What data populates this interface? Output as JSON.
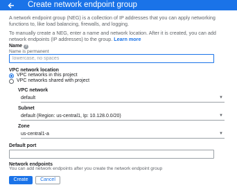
{
  "header": {
    "title": "Create network endpoint group"
  },
  "intro": {
    "paragraph1": "A network endpoint group (NEG) is a collection of IP addresses that you can apply networking functions to, like load balancing, firewalls, and logging.",
    "paragraph2": "To manually create a NEG, enter a name and network location. After it is created, you can add network endpoints (IP addresses) to the group.",
    "learn_more": "Learn more"
  },
  "name_field": {
    "label": "Name",
    "sublabel": "Name is permanent",
    "placeholder": "lowercase, no spaces",
    "value": ""
  },
  "vpc_location": {
    "label": "VPC network location",
    "options": [
      {
        "label": "VPC networks in this project",
        "selected": true
      },
      {
        "label": "VPC networks shared with project",
        "selected": false
      }
    ]
  },
  "vpc_network": {
    "label": "VPC network",
    "value": "default"
  },
  "subnet": {
    "label": "Subnet",
    "value": "default (Region: us-central1, Ip: 10.128.0.0/20)"
  },
  "zone": {
    "label": "Zone",
    "value": "us-central1-a"
  },
  "default_port": {
    "label": "Default port",
    "value": ""
  },
  "network_endpoints": {
    "label": "Network endpoints",
    "description": "You can add network endpoints after you create the network endpoint group"
  },
  "actions": {
    "create": "Create",
    "cancel": "Cancel"
  },
  "colors": {
    "accent": "#1a73e8",
    "text": "#202124",
    "muted": "#5f6368"
  }
}
